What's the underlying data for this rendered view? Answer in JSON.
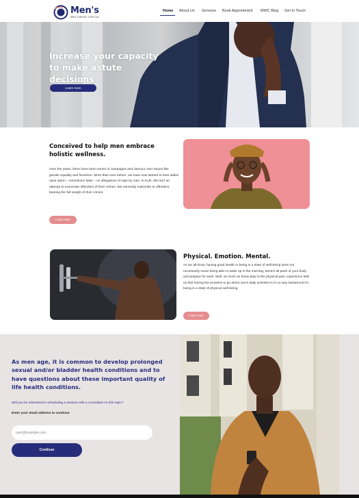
{
  "brand": {
    "title": "Men's",
    "subtitle": "WELLNESS CIRCLE",
    "color_primary": "#262c7a",
    "color_accent": "#e58d8f"
  },
  "nav": {
    "items": [
      {
        "label": "Home",
        "active": true
      },
      {
        "label": "About Us",
        "active": false
      },
      {
        "label": "Services",
        "active": false
      },
      {
        "label": "Book Appointment",
        "active": false
      },
      {
        "label": "MWC Blog",
        "active": false
      },
      {
        "label": "Get In Touch",
        "active": false
      }
    ]
  },
  "hero": {
    "title": "Increase your capacity to make astute decisions",
    "button": "Learn more"
  },
  "section_holistic": {
    "title": "Conceived to help men embrace holistic wellness.",
    "body": "Over the years, there have been series of campaigns and clamour over issues like gender equality and feminism. More than ever before, we have now started to hear ladies raise alarm – sometimes false – on allegations of rape by men. In truth, this isn't an attempt to exonerate offenders of their crimes. We earnestly subscribe to offenders bearing the full weight of their crimes.",
    "button": "Learn more"
  },
  "section_physical": {
    "title": "Physical. Emotion. Mental.",
    "body": "As we all know, having good health or being in a state of well-being does not necessarily mean being able to wake up in the morning, stretch all parts of your body and prepare for work. Well, as much as these play to the physical part, experience tells us that having the prowess to go about one's daily activities is in no way tantamount to being in a state of physical well-being.",
    "button": "Learn more"
  },
  "section_signup": {
    "heading": "As men age, it is common to develop prolonged sexual and/or bladder health conditions and to have questions about these important quality of life health conditions.",
    "question": "Will you be interested in scheduling a session with a consultant on this topic?",
    "email_label": "Enter your email address to continue",
    "email_placeholder": "user@example.com",
    "button": "Continue"
  }
}
